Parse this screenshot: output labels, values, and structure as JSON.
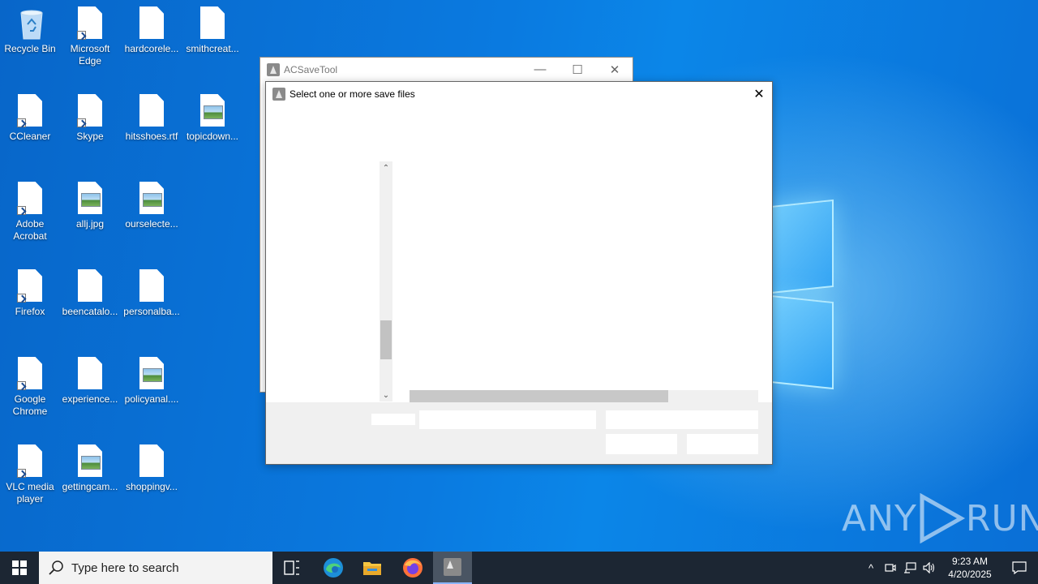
{
  "desktop": {
    "icons": [
      {
        "label": "Recycle Bin",
        "icon": "recycle-bin-icon"
      },
      {
        "label": "Microsoft Edge",
        "icon": "shortcut-doc-icon"
      },
      {
        "label": "hardcorele...",
        "icon": "doc-icon"
      },
      {
        "label": "smithcreat...",
        "icon": "doc-icon"
      },
      {
        "label": "CCleaner",
        "icon": "shortcut-doc-icon"
      },
      {
        "label": "Skype",
        "icon": "shortcut-doc-icon"
      },
      {
        "label": "hitsshoes.rtf",
        "icon": "doc-icon"
      },
      {
        "label": "topicdown...",
        "icon": "image-doc-icon"
      },
      {
        "label": "Adobe Acrobat",
        "icon": "shortcut-doc-icon"
      },
      {
        "label": "allj.jpg",
        "icon": "image-doc-icon"
      },
      {
        "label": "ourselecte...",
        "icon": "image-doc-icon"
      },
      {
        "label": "Firefox",
        "icon": "shortcut-doc-icon"
      },
      {
        "label": "beencatalo...",
        "icon": "doc-icon"
      },
      {
        "label": "personalba...",
        "icon": "doc-icon"
      },
      {
        "label": "Google Chrome",
        "icon": "shortcut-doc-icon"
      },
      {
        "label": "experience...",
        "icon": "doc-icon"
      },
      {
        "label": "policyanal....",
        "icon": "image-doc-icon"
      },
      {
        "label": "VLC media player",
        "icon": "shortcut-doc-icon"
      },
      {
        "label": "gettingcam...",
        "icon": "image-doc-icon"
      },
      {
        "label": "shoppingv...",
        "icon": "doc-icon"
      }
    ]
  },
  "bg_window": {
    "title": "ACSaveTool",
    "minimize": "—",
    "maximize": "☐",
    "close": "✕"
  },
  "dialog": {
    "title": "Select one or more save files",
    "close": "✕",
    "scroll_up": "⌃",
    "scroll_down": "⌄"
  },
  "taskbar": {
    "search_placeholder": "Type here to search",
    "time": "9:23 AM",
    "date": "4/20/2025"
  },
  "watermark": {
    "left": "ANY",
    "right": "RUN"
  },
  "colors": {
    "taskbar": "#1c2633",
    "desktop": "#0a78d7",
    "panel": "#f0f0f0"
  }
}
